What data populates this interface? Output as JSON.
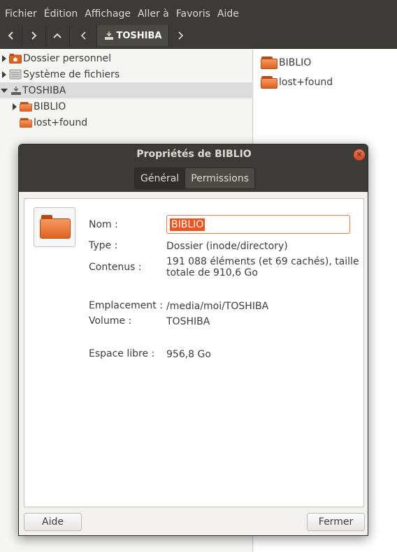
{
  "menubar": {
    "items": [
      "Fichier",
      "Édition",
      "Affichage",
      "Aller à",
      "Favoris",
      "Aide"
    ]
  },
  "toolbar": {
    "back_icon": "chevron-left-icon",
    "forward_icon": "chevron-right-icon",
    "up_icon": "chevron-up-icon",
    "crumb_label": "TOSHIBA"
  },
  "sidebar": {
    "items": [
      {
        "label": "Dossier personnel",
        "icon": "home-folder-icon"
      },
      {
        "label": "Système de fichiers",
        "icon": "drive-icon"
      },
      {
        "label": "TOSHIBA",
        "icon": "usb-drive-icon"
      },
      {
        "label": "BIBLIO",
        "icon": "folder-icon"
      },
      {
        "label": "lost+found",
        "icon": "folder-icon"
      }
    ]
  },
  "files": {
    "items": [
      {
        "label": "BIBLIO"
      },
      {
        "label": "lost+found"
      }
    ]
  },
  "dialog": {
    "title": "Propriétés de BIBLIO",
    "tabs": [
      "Général",
      "Permissions"
    ],
    "fields": {
      "name_label": "Nom :",
      "name_value": "BIBLIO",
      "type_label": "Type :",
      "type_value": "Dossier (inode/directory)",
      "contents_label": "Contenus :",
      "contents_value_1": "191 088 éléments (et 69 cachés), taille",
      "contents_value_2": "totale de 910,6 Go",
      "location_label": "Emplacement :",
      "location_value": "/media/moi/TOSHIBA",
      "volume_label": "Volume :",
      "volume_value": "TOSHIBA",
      "free_label": "Espace libre :",
      "free_value": "956,8 Go"
    },
    "help_button": "Aide",
    "close_button": "Fermer"
  },
  "colors": {
    "accent": "#e95420",
    "header_dark": "#3c3b37"
  }
}
